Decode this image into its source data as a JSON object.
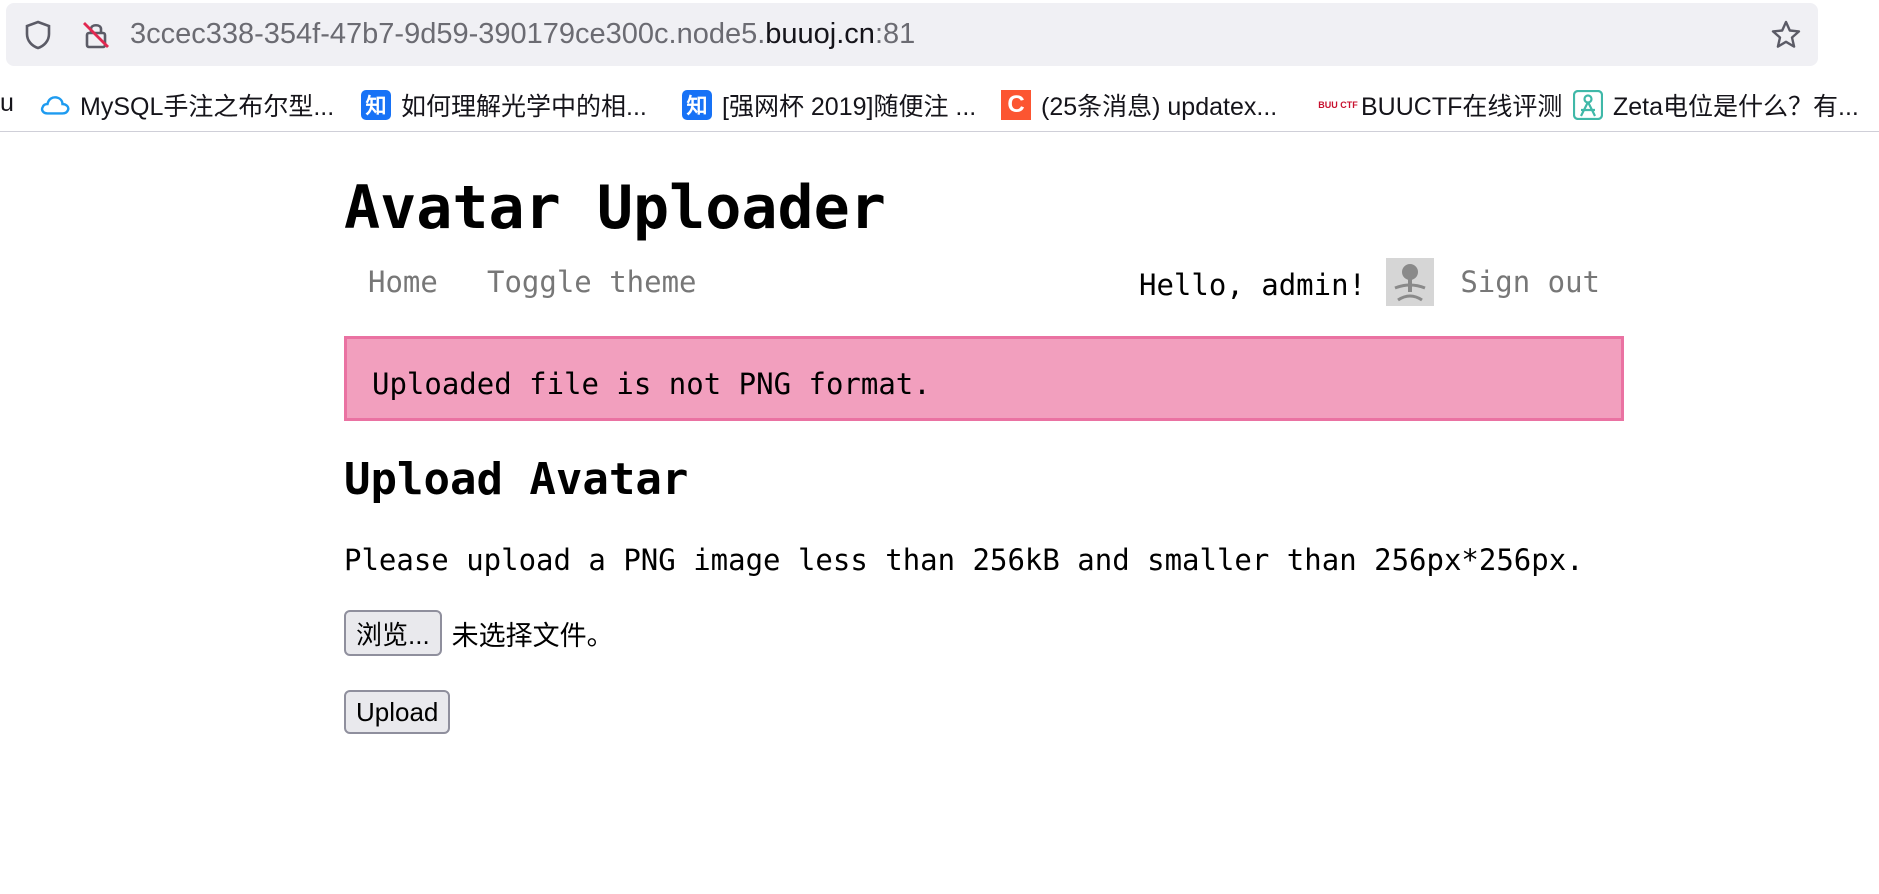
{
  "browser": {
    "url_prefix": "3ccec338-354f-47b7-9d59-390179ce300c.node5.",
    "url_host": "buuoj.cn",
    "url_port": ":81",
    "bookmarks_edge_text": "u",
    "bookmarks": [
      {
        "label": "MySQL手注之布尔型...",
        "icon": "cloud-icon"
      },
      {
        "label": "如何理解光学中的相...",
        "icon": "zhihu-icon",
        "icon_text": "知"
      },
      {
        "label": "[强网杯 2019]随便注 ...",
        "icon": "zhihu-icon",
        "icon_text": "知"
      },
      {
        "label": "(25条消息) updatex...",
        "icon": "csdn-icon",
        "icon_text": "C"
      },
      {
        "label": "BUUCTF在线评测",
        "icon": "buuctf-icon",
        "icon_text": "BUU CTF"
      },
      {
        "label": "Zeta电位是什么？有...",
        "icon": "zeta-icon"
      }
    ]
  },
  "page": {
    "site_title": "Avatar Uploader",
    "nav": {
      "home": "Home",
      "toggle_theme": "Toggle theme",
      "greeting": "Hello, admin!",
      "sign_out": "Sign out"
    },
    "alert_message": "Uploaded file is not PNG format.",
    "upload_heading": "Upload Avatar",
    "upload_description": "Please upload a PNG image less than 256kB and smaller than 256px*256px.",
    "browse_button": "浏览...",
    "file_status": "未选择文件。",
    "upload_button": "Upload"
  },
  "colors": {
    "alert_bg": "#f29fbe",
    "alert_border": "#ea72a2",
    "nav_link": "#777777",
    "chrome_bg": "#f0f0f4",
    "zhihu_blue": "#1772f6",
    "csdn_orange": "#fc5531"
  }
}
